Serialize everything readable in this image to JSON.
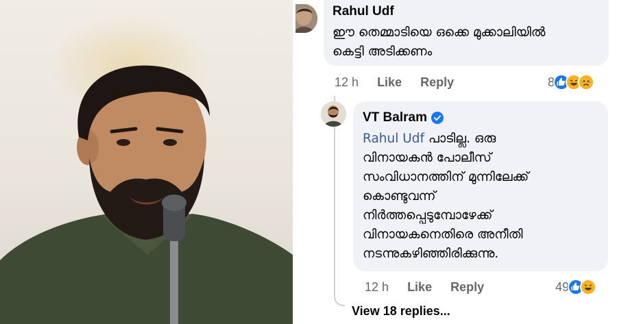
{
  "comments": [
    {
      "author": "Rahul Udf",
      "text": "ഈ തെമ്മാടിയെ ഒക്കെ മുക്കാലിയിൽ കെട്ടി അടിക്കണം",
      "time": "12 h",
      "like": "Like",
      "reply": "Reply",
      "reaction_count": "8",
      "reactions": [
        "like-icon",
        "haha-icon",
        "sad-icon"
      ]
    },
    {
      "author": "VT Balram",
      "verified": true,
      "mention": "Rahul Udf",
      "text_lines": [
        " പാടില്ല. ഒരു",
        "വിനായകൻ പോലീസ്",
        "സംവിധാനത്തിന് മുന്നിലേക്ക്",
        "കൊണ്ടുവന്ന്",
        "നിർത്തപ്പെടുമ്പോഴേക്ക്",
        "വിനായകനെതിരെ അനീതി",
        "നടന്നുകഴിഞ്ഞിരിക്കുന്നു."
      ],
      "time": "12 h",
      "like": "Like",
      "reply": "Reply",
      "reaction_count": "49",
      "reactions": [
        "like-icon",
        "haha-icon"
      ]
    }
  ],
  "view_replies": "View 18 replies...",
  "colors": {
    "like": "#1877f2",
    "haha": "#f7b125",
    "bubble": "#f0f2f5",
    "meta": "#65676b",
    "mention": "#385898",
    "verified": "#1877f2"
  }
}
